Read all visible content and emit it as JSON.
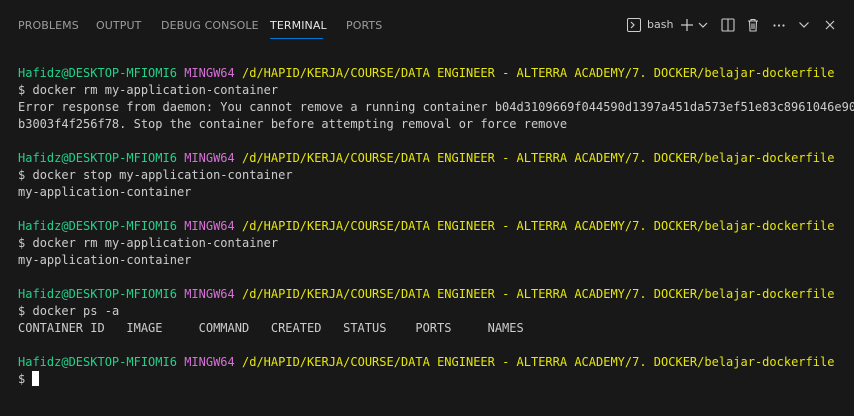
{
  "tabs": [
    {
      "label": "PROBLEMS"
    },
    {
      "label": "OUTPUT"
    },
    {
      "label": "DEBUG CONSOLE"
    },
    {
      "label": "TERMINAL"
    },
    {
      "label": "PORTS"
    }
  ],
  "active_tab": "TERMINAL",
  "shell": {
    "label": "bash"
  },
  "actions": {
    "terminal_icon": "terminal-icon",
    "new_terminal": "plus-icon",
    "dropdown": "chevron-down-icon",
    "split": "split-icon",
    "kill": "trash-icon",
    "more": "ellipsis-icon",
    "collapse": "chevron-up-icon",
    "close": "close-icon"
  },
  "prompt": {
    "user_host": "Hafidz@DESKTOP-MFIOMI6",
    "env": "MINGW64",
    "path": "/d/HAPID/KERJA/COURSE/DATA ENGINEER - ALTERRA ACADEMY/7. DOCKER/belajar-dockerfile",
    "symbol": "$"
  },
  "blocks": [
    {
      "command": "docker rm my-application-container",
      "output": [
        "Error response from daemon: You cannot remove a running container b04d3109669f044590d1397a451da573ef51e83c8961046e90",
        "b3003f4f256f78. Stop the container before attempting removal or force remove"
      ]
    },
    {
      "command": "docker stop my-application-container",
      "output": [
        "my-application-container"
      ]
    },
    {
      "command": "docker rm my-application-container",
      "output": [
        "my-application-container"
      ]
    },
    {
      "command": "docker ps -a",
      "output": [
        "CONTAINER ID   IMAGE     COMMAND   CREATED   STATUS    PORTS     NAMES"
      ]
    }
  ],
  "colors": {
    "background": "#181818",
    "user_host": "#23d18b",
    "env": "#d670d6",
    "path": "#e5e510",
    "text": "#cccccc",
    "accent": "#0078d4"
  }
}
